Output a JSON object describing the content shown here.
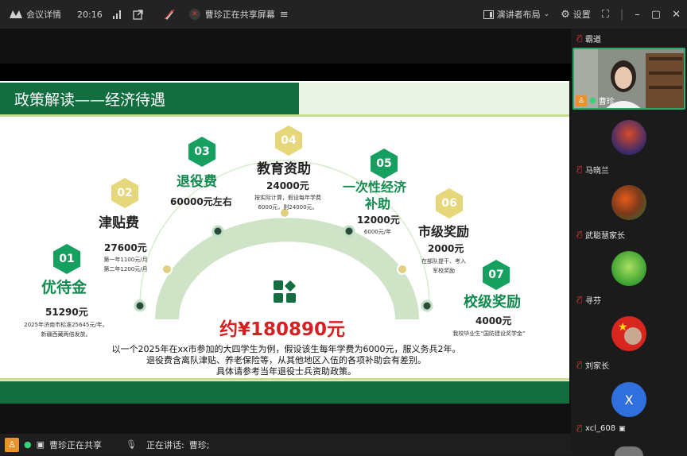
{
  "topbar": {
    "logo_label": "会议详情",
    "time": "20:16",
    "share_status": "曹珍正在共享屏幕",
    "layout_label": "演讲者布局",
    "settings_label": "设置"
  },
  "slide": {
    "title": "政策解读——经济待遇",
    "items": [
      {
        "num": "01",
        "label": "优待金",
        "amount": "51290元",
        "note1": "2025年济南市标准25645元/年。",
        "note2": "新疆西藏两倍发放。"
      },
      {
        "num": "02",
        "label": "津贴费",
        "amount": "27600元",
        "note1": "第一年1100元/月",
        "note2": "第二年1200元/月"
      },
      {
        "num": "03",
        "label": "退役费",
        "amount": "60000元左右"
      },
      {
        "num": "04",
        "label": "教育资助",
        "amount": "24000元",
        "note1": "按实际计算，假设每年学费",
        "note2": "6000元，则24000元。"
      },
      {
        "num": "05",
        "label": "一次性经济",
        "label2": "补助",
        "amount": "12000元",
        "note1": "6000元/年"
      },
      {
        "num": "06",
        "label": "市级奖励",
        "amount": "2000元",
        "note1": "在部队提干、考入",
        "note2": "军校奖励"
      },
      {
        "num": "07",
        "label": "校级奖励",
        "amount": "4000元",
        "note1": "我校毕业生“国防建设奖学金”"
      }
    ],
    "total": "约¥180890元",
    "caption1": "以一个2025年在xx市参加的大四学生为例，假设该生每年学费为6000元，服义务兵2年。",
    "caption2": "退役费含离队津贴、养老保险等，从其他地区入伍的各项补助会有差别。",
    "caption3": "具体请参考当年退役士兵资助政策。"
  },
  "participants": [
    {
      "name": "霸道"
    },
    {
      "name": "曹珍"
    },
    {
      "name": "马晓兰"
    },
    {
      "name": "武聪慧家长"
    },
    {
      "name": "寻芬"
    },
    {
      "name": "刘家长"
    },
    {
      "name": "xcl_608",
      "avatar_letter": "X"
    }
  ],
  "bottombar": {
    "sharing_label": "曹珍正在共享",
    "speaking_label": "正在讲话:",
    "speaker": "曹珍;"
  },
  "colors": {
    "slide_green": "#136e3f",
    "accent_green": "#16a060",
    "hex_yellow": "#e5d77a",
    "total_red": "#d82020"
  }
}
